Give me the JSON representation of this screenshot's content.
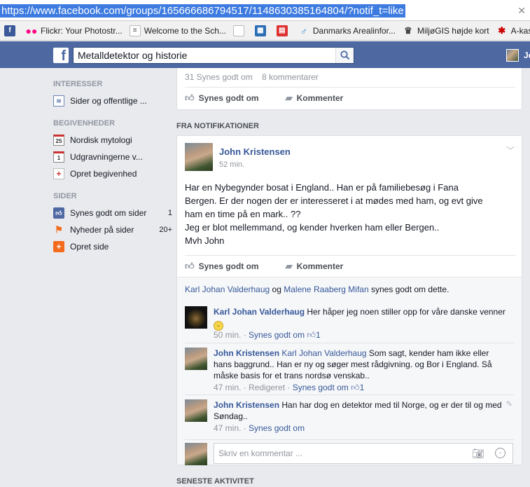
{
  "browser": {
    "url": "https://www.facebook.com/groups/165666686794517/1148630385164804/?notif_t=like",
    "bookmarks": [
      {
        "label": "",
        "icon": "facebook-icon"
      },
      {
        "label": "Flickr: Your Photostr...",
        "icon": "flickr-icon"
      },
      {
        "label": "Welcome to the Sch...",
        "icon": "page-icon"
      },
      {
        "label": "",
        "icon": "document-icon"
      },
      {
        "label": "",
        "icon": "blue-app-icon"
      },
      {
        "label": "",
        "icon": "grid-app-icon"
      },
      {
        "label": "Danmarks Arealinfor...",
        "icon": "leaf-icon"
      },
      {
        "label": "MiljøGIS højde kort",
        "icon": "crown-icon"
      },
      {
        "label": "A-kass",
        "icon": "red-star-icon"
      }
    ]
  },
  "header": {
    "logo": "f",
    "search_value": "Metalldetektor og historie",
    "user_name_fragment": "Jo"
  },
  "sidebar": {
    "sections": [
      {
        "title": "INTERESSER",
        "items": [
          {
            "label": "Sider og offentlige ...",
            "count": "",
            "icon": "rss-icon"
          }
        ]
      },
      {
        "title": "BEGIVENHEDER",
        "items": [
          {
            "label": "Nordisk mytologi",
            "count": "",
            "icon": "calendar-25-icon",
            "iconText": "25"
          },
          {
            "label": "Udgravningerne v...",
            "count": "",
            "icon": "calendar-1-icon",
            "iconText": "1"
          },
          {
            "label": "Opret begivenhed",
            "count": "",
            "icon": "add-event-icon",
            "iconText": "+"
          }
        ]
      },
      {
        "title": "SIDER",
        "items": [
          {
            "label": "Synes godt om sider",
            "count": "1",
            "icon": "like-icon"
          },
          {
            "label": "Nyheder på sider",
            "count": "20+",
            "icon": "flag-icon"
          },
          {
            "label": "Opret side",
            "count": "",
            "icon": "add-page-icon",
            "iconText": "+"
          }
        ]
      }
    ]
  },
  "prev_post": {
    "likes": "31 Synes godt om",
    "comments": "8 kommentarer",
    "like_label": "Synes godt om",
    "comment_label": "Kommenter"
  },
  "section_from_notifications": "FRA NOTIFIKATIONER",
  "post": {
    "author": "John Kristensen",
    "time": "52 min.",
    "text_lines": [
      "Har en Nybegynder bosat i England.. Han er på familiebesøg i Fana",
      "Bergen. Er der nogen der er interesseret i at mødes med ham, og evt give",
      "ham en time på en mark.. ??",
      "Jeg er blot mellemmand, og kender hverken ham eller Bergen..",
      "Mvh John"
    ],
    "like_label": "Synes godt om",
    "comment_label": "Kommenter",
    "likers": [
      "Karl Johan Valderhaug",
      "Malene Raaberg Mifan"
    ],
    "likers_and": "og",
    "likers_suffix": "synes godt om dette."
  },
  "comments": [
    {
      "author": "Karl Johan Valderhaug",
      "tag": "",
      "text": "Her håper jeg noen stiller opp for våre danske venner",
      "time": "50 min.",
      "edited": "",
      "like_label": "Synes godt om",
      "like_count": "1"
    },
    {
      "author": "John Kristensen",
      "tag": "Karl Johan Valderhaug",
      "text": "Som sagt, kender ham ikke eller hans baggrund.. Han er ny og søger mest rådgivning. og Bor i England. Så måske basis for et trans nordsø venskab..",
      "time": "47 min.",
      "edited": "Redigeret",
      "like_label": "Synes godt om",
      "like_count": "1"
    },
    {
      "author": "John Kristensen",
      "tag": "",
      "text": "Han har dog en detektor med til Norge, og er der til og med Søndag..",
      "time": "47 min.",
      "edited": "",
      "like_label": "Synes godt om",
      "like_count": ""
    }
  ],
  "write_comment_placeholder": "Skriv en kommentar ...",
  "section_recent_activity": "SENESTE AKTIVITET",
  "colors": {
    "fb_blue": "#4e69a2",
    "link": "#365899",
    "url_highlight": "#3d7be0"
  }
}
